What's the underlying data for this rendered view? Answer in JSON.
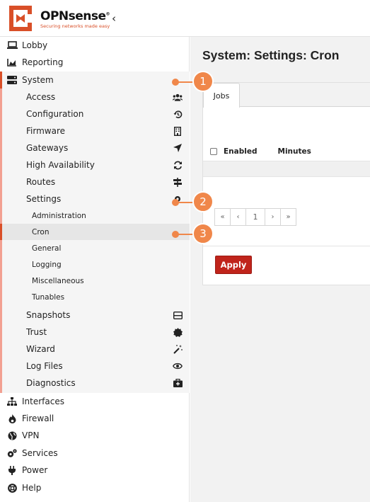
{
  "brand": {
    "name": "OPNsense",
    "trademark": "®",
    "tagline": "Securing networks made easy"
  },
  "header": {
    "collapse_icon": "chevron-left-icon",
    "collapse_glyph": "‹"
  },
  "sidebar": {
    "top_items": [
      {
        "label": "Lobby",
        "icon": "laptop-icon"
      },
      {
        "label": "Reporting",
        "icon": "area-chart-icon"
      }
    ],
    "system": {
      "label": "System",
      "icon": "server-icon",
      "children": [
        {
          "label": "Access",
          "icon": "users-icon"
        },
        {
          "label": "Configuration",
          "icon": "history-icon"
        },
        {
          "label": "Firmware",
          "icon": "building-icon"
        },
        {
          "label": "Gateways",
          "icon": "location-arrow-icon"
        },
        {
          "label": "High Availability",
          "icon": "refresh-icon"
        },
        {
          "label": "Routes",
          "icon": "map-signs-icon"
        },
        {
          "label": "Settings",
          "icon": "cog-icon"
        }
      ],
      "settings_children": [
        {
          "label": "Administration"
        },
        {
          "label": "Cron",
          "active": true
        },
        {
          "label": "General"
        },
        {
          "label": "Logging"
        },
        {
          "label": "Miscellaneous"
        },
        {
          "label": "Tunables"
        }
      ],
      "more_children": [
        {
          "label": "Snapshots",
          "icon": "hdd-icon"
        },
        {
          "label": "Trust",
          "icon": "certificate-icon"
        },
        {
          "label": "Wizard",
          "icon": "magic-icon"
        },
        {
          "label": "Log Files",
          "icon": "eye-icon"
        },
        {
          "label": "Diagnostics",
          "icon": "medkit-icon"
        }
      ]
    },
    "bottom_items": [
      {
        "label": "Interfaces",
        "icon": "sitemap-icon"
      },
      {
        "label": "Firewall",
        "icon": "fire-icon"
      },
      {
        "label": "VPN",
        "icon": "globe-icon"
      },
      {
        "label": "Services",
        "icon": "cogs-icon"
      },
      {
        "label": "Power",
        "icon": "plug-icon"
      },
      {
        "label": "Help",
        "icon": "life-ring-icon"
      }
    ]
  },
  "main": {
    "title": "System: Settings: Cron",
    "tabs": [
      {
        "label": "Jobs",
        "active": true
      }
    ],
    "grid": {
      "columns": [
        "Enabled",
        "Minutes"
      ]
    },
    "pager": {
      "first": "«",
      "prev": "‹",
      "current": "1",
      "next": "›",
      "last": "»"
    },
    "apply_label": "Apply"
  },
  "callouts": [
    "1",
    "2",
    "3"
  ],
  "colors": {
    "accent": "#d94f28",
    "callout": "#f0874a",
    "apply": "#c0241b",
    "sidebar_bar": "#f2a091"
  }
}
